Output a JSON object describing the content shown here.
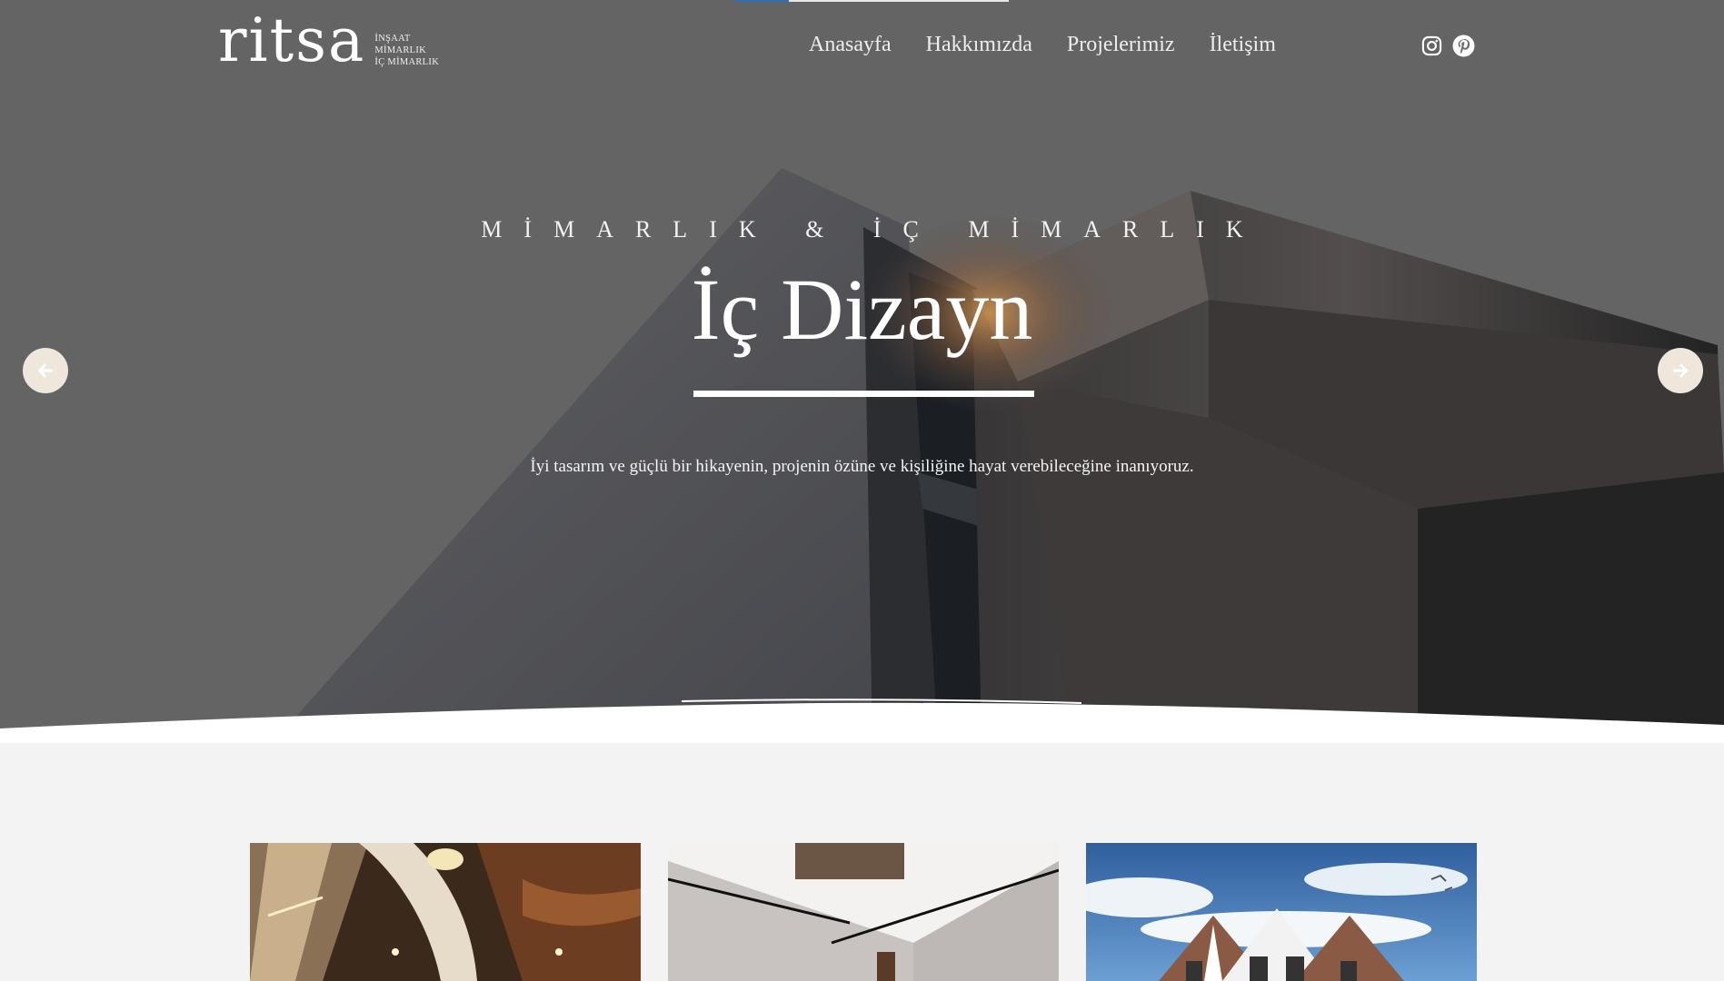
{
  "brand": {
    "name": "ritsa",
    "tagline_lines": [
      "İNŞAAT",
      "MİMARLIK",
      "İÇ MİMARLIK"
    ]
  },
  "nav": {
    "items": [
      {
        "label": "Anasayfa"
      },
      {
        "label": "Hakkımızda"
      },
      {
        "label": "Projelerimiz"
      },
      {
        "label": "İletişim"
      }
    ]
  },
  "social": [
    {
      "icon": "instagram-icon"
    },
    {
      "icon": "pinterest-icon"
    }
  ],
  "hero": {
    "kicker": "MİMARLIK & İÇ MİMARLIK",
    "title": "İç Dizayn",
    "description": "İyi tasarım ve güçlü bir hikayenin, projenin özüne ve kişiliğine hayat verebileceğine inanıyoruz.",
    "slider_progress": 0.2
  },
  "slider": {
    "prev_icon": "arrow-left-icon",
    "next_icon": "arrow-right-icon"
  },
  "colors": {
    "hero_overlay": "#6d6d6d",
    "arrow_bg": "#efe6dc",
    "arrow_fg": "#ffffff",
    "progress_fill": "#2f6fb3",
    "page_bg": "#f3f3f3"
  },
  "projects": [
    {
      "thumbnail": "interior-atrium-image"
    },
    {
      "thumbnail": "interior-room-image"
    },
    {
      "thumbnail": "house-exterior-image"
    }
  ]
}
